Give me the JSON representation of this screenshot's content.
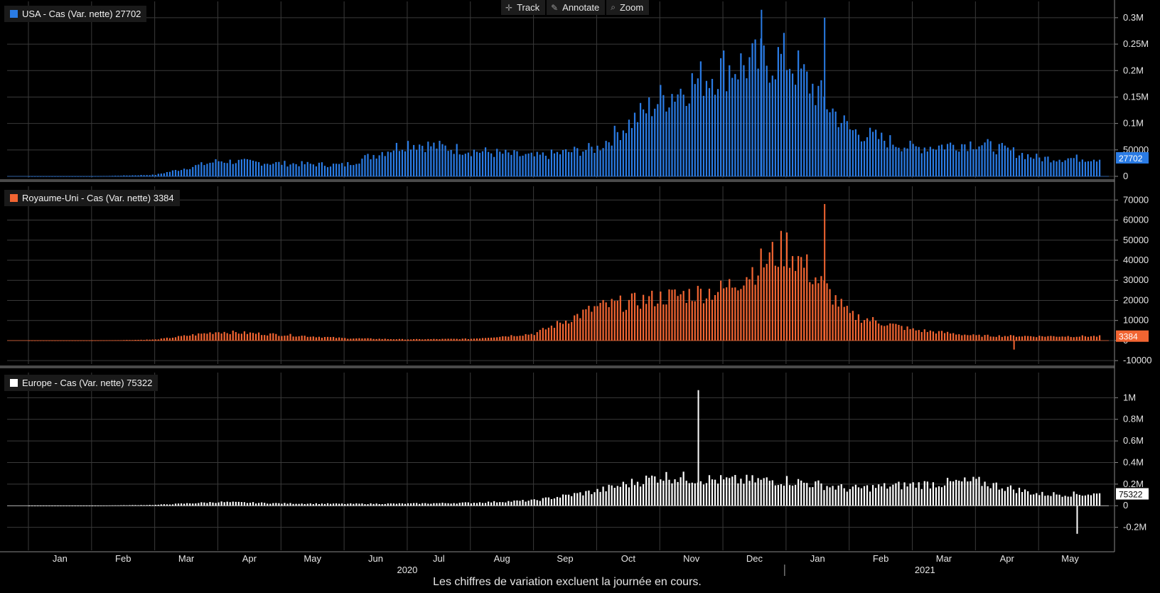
{
  "toolbar": {
    "track": "Track",
    "annotate": "Annotate",
    "zoom": "Zoom"
  },
  "footnote": "Les chiffres de variation excluent la journée en cours.",
  "colors": {
    "usa": "#2a7be4",
    "uk": "#f26532",
    "europe": "#ffffff"
  },
  "chart_data": [
    {
      "type": "bar",
      "series": [
        {
          "name": "USA - Cas (Var. nette) 27702",
          "color": "#2a7be4"
        }
      ],
      "last_value_label": "27702",
      "y_ticks": [
        0,
        50000,
        100000,
        150000,
        200000,
        250000,
        300000
      ],
      "y_tick_labels": [
        "0",
        "50000",
        "0.1M",
        "0.15M",
        "0.2M",
        "0.25M",
        "0.3M"
      ],
      "ylim": [
        0,
        320000
      ],
      "grid": true,
      "monthly_typical": [
        {
          "month": "Jan 2020",
          "value": 0
        },
        {
          "month": "Feb 2020",
          "value": 0
        },
        {
          "month": "Mar 2020",
          "value": 3000
        },
        {
          "month": "Apr 2020",
          "value": 30000
        },
        {
          "month": "May 2020",
          "value": 25000
        },
        {
          "month": "Jun 2020",
          "value": 22000
        },
        {
          "month": "Jul 2020",
          "value": 65000
        },
        {
          "month": "Aug 2020",
          "value": 50000
        },
        {
          "month": "Sep 2020",
          "value": 38000
        },
        {
          "month": "Oct 2020",
          "value": 55000
        },
        {
          "month": "Nov 2020",
          "value": 150000
        },
        {
          "month": "Dec 2020",
          "value": 210000
        },
        {
          "month": "Jan 2021",
          "value": 230000
        },
        {
          "month": "Feb 2021",
          "value": 90000
        },
        {
          "month": "Mar 2021",
          "value": 55000
        },
        {
          "month": "Apr 2021",
          "value": 65000
        },
        {
          "month": "May 2021",
          "value": 35000
        }
      ],
      "peak_values": [
        {
          "date": "Dec 2020",
          "value": 315000
        },
        {
          "date": "Jan 2021",
          "value": 300000
        }
      ]
    },
    {
      "type": "bar",
      "series": [
        {
          "name": "Royaume-Uni - Cas (Var. nette) 3384",
          "color": "#f26532"
        }
      ],
      "last_value_label": "3384",
      "y_ticks": [
        -10000,
        0,
        10000,
        20000,
        30000,
        40000,
        50000,
        60000,
        70000
      ],
      "y_tick_labels": [
        "-10000",
        "0",
        "10000",
        "20000",
        "30000",
        "40000",
        "50000",
        "60000",
        "70000"
      ],
      "ylim": [
        -11000,
        74000
      ],
      "grid": true,
      "monthly_typical": [
        {
          "month": "Jan 2020",
          "value": 0
        },
        {
          "month": "Feb 2020",
          "value": 0
        },
        {
          "month": "Mar 2020",
          "value": 500
        },
        {
          "month": "Apr 2020",
          "value": 4500
        },
        {
          "month": "May 2020",
          "value": 3000
        },
        {
          "month": "Jun 2020",
          "value": 1200
        },
        {
          "month": "Jul 2020",
          "value": 600
        },
        {
          "month": "Aug 2020",
          "value": 900
        },
        {
          "month": "Sep 2020",
          "value": 3500
        },
        {
          "month": "Oct 2020",
          "value": 17000
        },
        {
          "month": "Nov 2020",
          "value": 22000
        },
        {
          "month": "Dec 2020",
          "value": 26000
        },
        {
          "month": "Jan 2021",
          "value": 48000
        },
        {
          "month": "Feb 2021",
          "value": 13000
        },
        {
          "month": "Mar 2021",
          "value": 5500
        },
        {
          "month": "Apr 2021",
          "value": 2500
        },
        {
          "month": "May 2021",
          "value": 2200
        }
      ],
      "peak_values": [
        {
          "date": "Jan 2021",
          "value": 68000
        },
        {
          "date": "Apr 2021",
          "value": -4500
        }
      ]
    },
    {
      "type": "bar",
      "series": [
        {
          "name": "Europe - Cas (Var. nette) 75322",
          "color": "#ffffff"
        }
      ],
      "last_value_label": "75322",
      "y_ticks": [
        -200000,
        0,
        200000,
        400000,
        600000,
        800000,
        1000000
      ],
      "y_tick_labels": [
        "-0.2M",
        "0",
        "0.2M",
        "0.4M",
        "0.6M",
        "0.8M",
        "1M"
      ],
      "ylim": [
        -400000,
        1180000
      ],
      "grid": true,
      "monthly_typical": [
        {
          "month": "Jan 2020",
          "value": 0
        },
        {
          "month": "Feb 2020",
          "value": 0
        },
        {
          "month": "Mar 2020",
          "value": 8000
        },
        {
          "month": "Apr 2020",
          "value": 35000
        },
        {
          "month": "May 2020",
          "value": 22000
        },
        {
          "month": "Jun 2020",
          "value": 18000
        },
        {
          "month": "Jul 2020",
          "value": 20000
        },
        {
          "month": "Aug 2020",
          "value": 28000
        },
        {
          "month": "Sep 2020",
          "value": 50000
        },
        {
          "month": "Oct 2020",
          "value": 140000
        },
        {
          "month": "Nov 2020",
          "value": 280000
        },
        {
          "month": "Dec 2020",
          "value": 240000
        },
        {
          "month": "Jan 2021",
          "value": 240000
        },
        {
          "month": "Feb 2021",
          "value": 160000
        },
        {
          "month": "Mar 2021",
          "value": 200000
        },
        {
          "month": "Apr 2021",
          "value": 230000
        },
        {
          "month": "May 2021",
          "value": 110000
        }
      ],
      "peak_values": [
        {
          "date": "Nov 2020",
          "value": 1070000
        },
        {
          "date": "May 2021",
          "value": -260000
        }
      ]
    }
  ],
  "x_axis": {
    "months": [
      "Jan",
      "Feb",
      "Mar",
      "Apr",
      "May",
      "Jun",
      "Jul",
      "Aug",
      "Sep",
      "Oct",
      "Nov",
      "Dec",
      "Jan",
      "Feb",
      "Mar",
      "Apr",
      "May"
    ],
    "years": [
      "2020",
      "2021"
    ]
  }
}
